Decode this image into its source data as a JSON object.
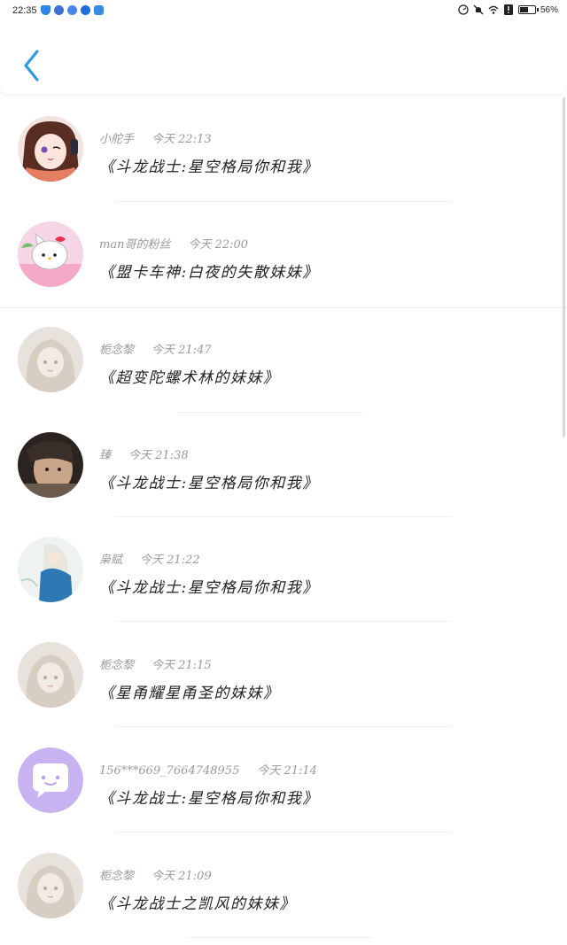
{
  "status_bar": {
    "time": "22:35",
    "battery_text": "56%",
    "notification_colors": [
      "#2f87e8",
      "#3d6fd8",
      "#4a86e8",
      "#1f6fd8",
      "#3b8ce0"
    ]
  },
  "header": {
    "back_icon": "chevron-left-icon",
    "accent_color": "#2f9be6"
  },
  "comments": [
    {
      "user": "小舵手",
      "time": "今天 22:13",
      "title": "《斗龙战士:星空格局你和我》",
      "avatar": "anime-girl-headphones"
    },
    {
      "user": "man哥的粉丝",
      "time": "今天 22:00",
      "title": "《盟卡车神:白夜的失散妹妹》",
      "avatar": "hello-kitty"
    },
    {
      "user": "栀念黎",
      "time": "今天 21:47",
      "title": "《超变陀螺术林的妹妹》",
      "avatar": "pastel-girl"
    },
    {
      "user": "臻",
      "time": "今天 21:38",
      "title": "《斗龙战士:星空格局你和我》",
      "avatar": "dark-photo"
    },
    {
      "user": "枭赋",
      "time": "今天 21:22",
      "title": "《斗龙战士:星空格局你和我》",
      "avatar": "blue-character"
    },
    {
      "user": "栀念黎",
      "time": "今天 21:15",
      "title": "《星甬耀星甬圣的妹妹》",
      "avatar": "pastel-girl"
    },
    {
      "user": "156***669_7664748955",
      "time": "今天 21:14",
      "title": "《斗龙战士:星空格局你和我》",
      "avatar": "default-chat-bubble"
    },
    {
      "user": "栀念黎",
      "time": "今天 21:09",
      "title": "《斗龙战士之凯风的妹妹》",
      "avatar": "pastel-girl"
    }
  ]
}
